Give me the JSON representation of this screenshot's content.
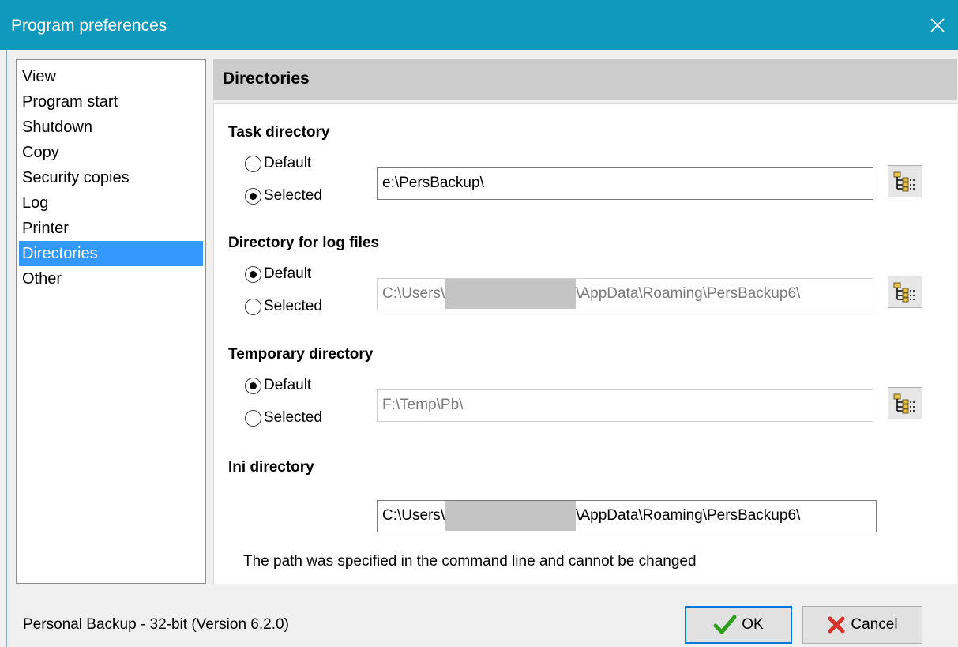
{
  "window": {
    "title": "Program preferences"
  },
  "sidebar": {
    "items": [
      {
        "label": "View"
      },
      {
        "label": "Program start"
      },
      {
        "label": "Shutdown"
      },
      {
        "label": "Copy"
      },
      {
        "label": "Security copies"
      },
      {
        "label": "Log"
      },
      {
        "label": "Printer"
      },
      {
        "label": "Directories",
        "selected": true
      },
      {
        "label": "Other"
      }
    ]
  },
  "panel": {
    "title": "Directories"
  },
  "task_directory": {
    "label": "Task directory",
    "option_default": "Default",
    "option_selected": "Selected",
    "selected_option": "Selected",
    "path": "e:\\PersBackup\\"
  },
  "log_directory": {
    "label": "Directory for log files",
    "option_default": "Default",
    "option_selected": "Selected",
    "selected_option": "Default",
    "path_prefix": "C:\\Users\\",
    "path_suffix": "\\AppData\\Roaming\\PersBackup6\\"
  },
  "temp_directory": {
    "label": "Temporary directory",
    "option_default": "Default",
    "option_selected": "Selected",
    "selected_option": "Default",
    "path": "F:\\Temp\\Pb\\"
  },
  "ini_directory": {
    "label": "Ini directory",
    "path_prefix": "C:\\Users\\",
    "path_suffix": "\\AppData\\Roaming\\PersBackup6\\",
    "note": "The path was specified in the command line and cannot be changed"
  },
  "footer": {
    "version": "Personal Backup - 32-bit (Version 6.2.0)",
    "ok_label": "OK",
    "cancel_label": "Cancel"
  },
  "colors": {
    "titlebar": "#0e99bd",
    "selection": "#3399ff",
    "header": "#cccccc",
    "ok_check": "#2e9e1f",
    "cancel_x": "#d9342b"
  },
  "icons": {
    "close": "close-icon",
    "browse": "folder-tree-icon",
    "ok": "checkmark-icon",
    "cancel": "cross-icon"
  }
}
